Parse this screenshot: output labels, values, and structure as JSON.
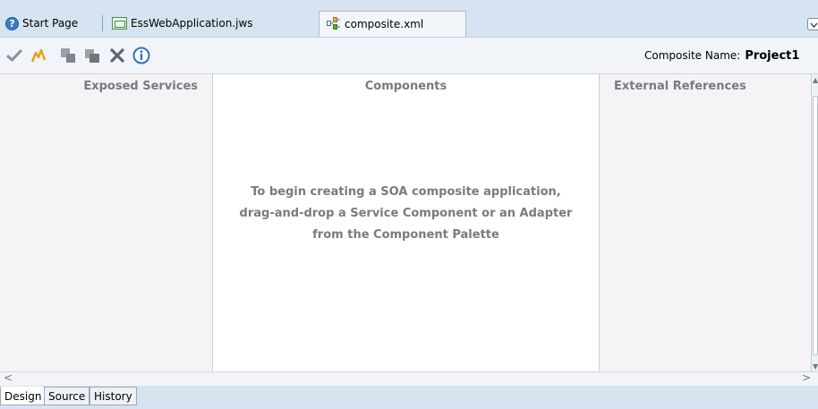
{
  "editor_tabs": [
    {
      "label": "Start Page",
      "icon": "help-icon"
    },
    {
      "label": "EssWebApplication.jws",
      "icon": "workspace-icon"
    },
    {
      "label": "composite.xml",
      "icon": "composite-icon",
      "active": true
    }
  ],
  "toolbar": {
    "buttons": [
      "validate-icon",
      "test-icon",
      "copy-icon",
      "paste-icon",
      "delete-icon",
      "info-icon"
    ],
    "composite_name_label": "Composite Name:",
    "composite_name_value": "Project1"
  },
  "canvas": {
    "exposed_services_title": "Exposed Services",
    "components_title": "Components",
    "external_references_title": "External References",
    "hint_line1": "To begin creating a SOA composite application,",
    "hint_line2": "drag-and-drop a Service Component or an Adapter",
    "hint_line3": "from the Component Palette"
  },
  "scrollbar": {
    "left_arrow": "<",
    "right_arrow": ">",
    "up_arrow": "▲",
    "down_arrow": "▼"
  },
  "bottom_tabs": [
    {
      "label": "Design",
      "active": true
    },
    {
      "label": "Source"
    },
    {
      "label": "History"
    }
  ],
  "colors": {
    "tabbar_bg": "#d6e4f1",
    "lane_bg": "#f5f3f6",
    "lane_title": "#7d7880",
    "validate_green": "#6f9b3a",
    "delete_gray": "#5a6470",
    "info_blue": "#2f6fc4"
  }
}
